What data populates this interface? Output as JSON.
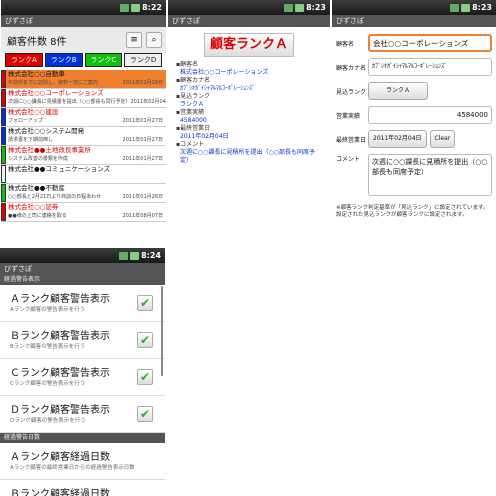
{
  "app_title": "びずさぽ",
  "s1": {
    "time": "8:22",
    "count": "顧客件数 8件",
    "tabs": [
      {
        "label": "ランクA",
        "color": "#e00000"
      },
      {
        "label": "ランクB",
        "color": "#0030e0"
      },
      {
        "label": "ランクC",
        "color": "#10c010"
      },
      {
        "label": "ランクD",
        "color": "#eeeeee"
      }
    ],
    "rows": [
      {
        "name": "株式会社○○自動車",
        "sub": "午前中までに訪問し、資料一式にご案内",
        "date": "2011年02月28日",
        "color": "#e00000",
        "bg": "#f08030",
        "red": false
      },
      {
        "name": "株式会社○○コーポレーションズ",
        "sub": "次週に○○課長に見積書を提出（○○部長も同行予定）",
        "date": "2011年02月04日",
        "color": "#e00000",
        "bg": "#fff",
        "red": true
      },
      {
        "name": "株式会社○○建設",
        "sub": "フォローアップ",
        "date": "2011年01月27日",
        "color": "#0030e0",
        "bg": "#fff",
        "red": true
      },
      {
        "name": "株式会社○○システム開発",
        "sub": "請求書を下期前倒し",
        "date": "2011年01月27日",
        "color": "#0030e0",
        "bg": "#fff",
        "red": false
      },
      {
        "name": "株式会社●●土地改良事業所",
        "sub": "システム改善の書類を作成",
        "date": "2011年01月27日",
        "color": "#10c010",
        "bg": "#fff",
        "red": true
      },
      {
        "name": "株式会社●●コミュニケーションズ",
        "sub": "",
        "date": "",
        "color": "#eeeeee",
        "bg": "#fff",
        "red": false
      },
      {
        "name": "株式会社●●不動産",
        "sub": "○○部長と2月21日より商談の日程あわせ",
        "date": "2011年01月26日",
        "color": "#10c010",
        "bg": "#fff",
        "red": false
      },
      {
        "name": "株式会社○○証券",
        "sub": "●●様の上司に連絡を取る",
        "date": "2011年08月07日",
        "color": "#e00000",
        "bg": "#fff",
        "red": true
      }
    ]
  },
  "s2": {
    "time": "8:23",
    "rank": "顧客ランクＡ",
    "items": [
      {
        "k": "▪顧客名",
        "v": "株式会社○○コーポレーションズ"
      },
      {
        "k": "▪顧客カナ名",
        "v": "ｶﾌﾞｼｷｶﾞｲｼｬﾏﾙﾏﾙｺｰﾎﾟﾚｰｼｮﾝｽﾞ"
      },
      {
        "k": "▪見込ランク",
        "v": "ランクＡ"
      },
      {
        "k": "▪営業実績",
        "v": "4584000"
      },
      {
        "k": "▪最終営業日",
        "v": "2011年02月04日"
      },
      {
        "k": "▪コメント",
        "v": "次週に○○課長に見積所を提出（○○部長も同席予定）"
      }
    ]
  },
  "s3": {
    "time": "8:23",
    "name_label": "顧客名",
    "name": "会社○○コーポレーションズ",
    "kana_label": "顧客カナ名",
    "kana": "ｶﾌﾞｼｷｶﾞｲｼｬﾏﾙﾏﾙｺｰﾎﾟﾚｰｼｮﾝｽﾞ",
    "rank_label": "見込ランク",
    "rank": "ランクＡ",
    "sales_label": "営業実績",
    "sales": "4584000",
    "date_label": "最終営業日",
    "date": "2011年02月04日",
    "clear": "Clear",
    "comment_label": "コメント",
    "comment": "次週に○○課長に見積所を提出（○○部長も同席予定）",
    "note": "※顧客ランク判定基準が「見込ランク」に設定されています。設定された見込ランクが顧客ランクに設定されます。"
  },
  "s4": {
    "time": "8:24",
    "sec1": "経過警告表示",
    "prefs": [
      {
        "t": "Ａランク顧客警告表示",
        "s": "Aランク顧客の警告表示を行う"
      },
      {
        "t": "Ｂランク顧客警告表示",
        "s": "Bランク顧客の警告表示を行う"
      },
      {
        "t": "Ｃランク顧客警告表示",
        "s": "Cランク顧客の警告表示を行う"
      },
      {
        "t": "Ｄランク顧客警告表示",
        "s": "Dランク顧客の警告表示を行う"
      }
    ],
    "sec2": "経過警告日数",
    "days": [
      {
        "t": "Ａランク顧客経過日数",
        "s": "Aランク顧客の最終営業日からの経過警告表示日数"
      },
      {
        "t": "Ｂランク顧客経過日数",
        "s": ""
      }
    ]
  }
}
